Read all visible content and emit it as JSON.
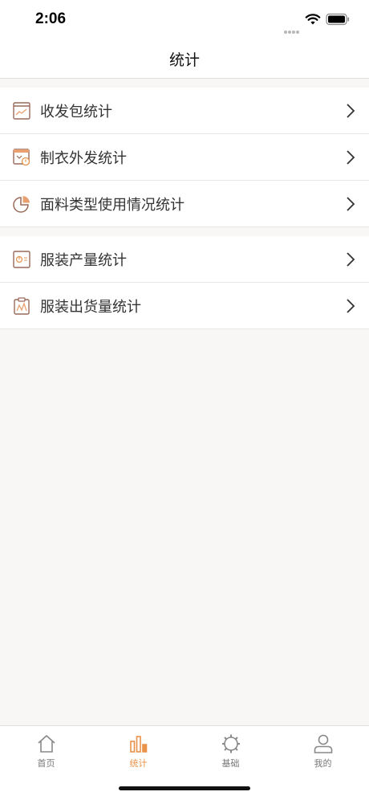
{
  "status_bar": {
    "time": "2:06"
  },
  "nav": {
    "title": "统计"
  },
  "groups": [
    {
      "items": [
        {
          "label": "收发包统计",
          "icon": "chart-window-icon"
        },
        {
          "label": "制衣外发统计",
          "icon": "clothing-send-icon"
        },
        {
          "label": "面料类型使用情况统计",
          "icon": "pie-chart-icon"
        }
      ]
    },
    {
      "items": [
        {
          "label": "服装产量统计",
          "icon": "output-report-icon"
        },
        {
          "label": "服装出货量统计",
          "icon": "clipboard-wave-icon"
        }
      ]
    }
  ],
  "tab_bar": {
    "tabs": [
      {
        "label": "首页",
        "icon": "home-icon"
      },
      {
        "label": "统计",
        "icon": "bar-chart-icon",
        "active": true
      },
      {
        "label": "基础",
        "icon": "gear-icon"
      },
      {
        "label": "我的",
        "icon": "user-icon"
      }
    ]
  },
  "colors": {
    "accent": "#e8924a",
    "icon_brown": "#9a6a5a"
  }
}
